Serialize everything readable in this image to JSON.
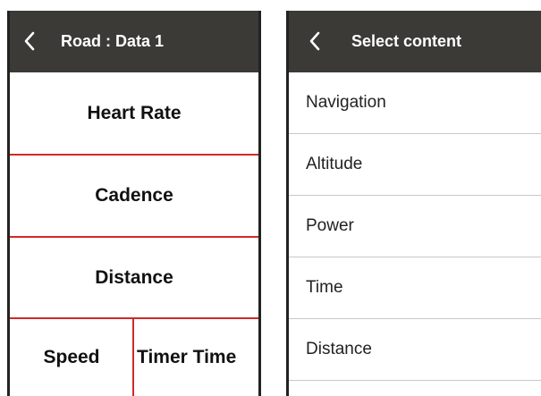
{
  "data_screen": {
    "title": "Road : Data 1",
    "fields": [
      {
        "label": "Heart Rate"
      },
      {
        "label": "Cadence"
      },
      {
        "label": "Distance"
      },
      {
        "label": "Speed"
      },
      {
        "label": "Timer Time"
      }
    ]
  },
  "select_screen": {
    "title": "Select content",
    "items": [
      {
        "label": "Navigation"
      },
      {
        "label": "Altitude"
      },
      {
        "label": "Power"
      },
      {
        "label": "Time"
      },
      {
        "label": "Distance"
      }
    ]
  },
  "colors": {
    "header_bg": "#3b3a37",
    "divider_red": "#cf2a2a",
    "list_divider": "#c8c8c8"
  },
  "icons": {
    "back": "chevron-left-icon"
  }
}
